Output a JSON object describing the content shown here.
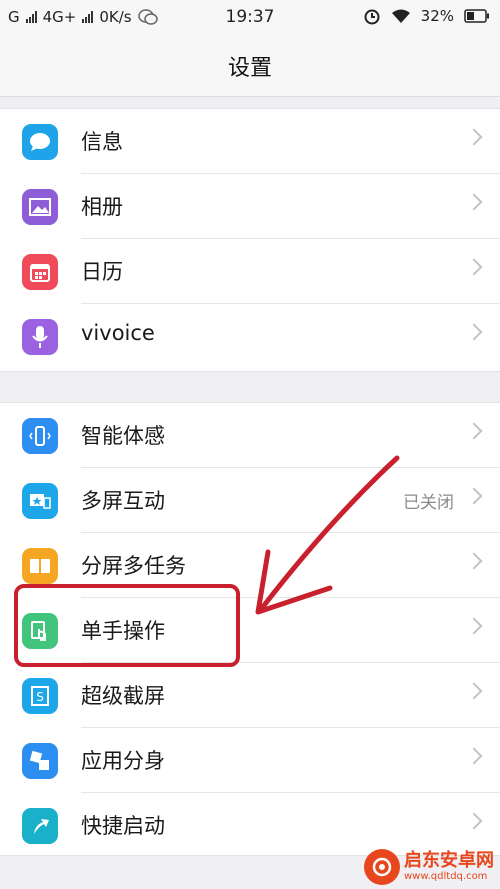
{
  "status_bar": {
    "carrier": "G",
    "network": "4G+",
    "speed": "0K/s",
    "time": "19:37",
    "battery": "32%"
  },
  "header": {
    "title": "设置"
  },
  "group1": [
    {
      "label": "信息",
      "icon": "message-icon",
      "color": "#1fa3e9"
    },
    {
      "label": "相册",
      "icon": "album-icon",
      "color": "#8e5ed9"
    },
    {
      "label": "日历",
      "icon": "calendar-icon",
      "color": "#ef4b5a"
    },
    {
      "label": "vivoice",
      "icon": "microphone-icon",
      "color": "#9a62e0"
    }
  ],
  "group2": [
    {
      "label": "智能体感",
      "icon": "phone-motion-icon",
      "color": "#2b8ef0",
      "value": ""
    },
    {
      "label": "多屏互动",
      "icon": "multiscreen-icon",
      "color": "#1da6e8",
      "value": "已关闭"
    },
    {
      "label": "分屏多任务",
      "icon": "split-screen-icon",
      "color": "#f5a623",
      "value": ""
    },
    {
      "label": "单手操作",
      "icon": "one-hand-icon",
      "color": "#41c47c",
      "value": ""
    },
    {
      "label": "超级截屏",
      "icon": "screenshot-icon",
      "color": "#1da6e8",
      "value": ""
    },
    {
      "label": "应用分身",
      "icon": "app-clone-icon",
      "color": "#2b8ef0",
      "value": ""
    },
    {
      "label": "快捷启动",
      "icon": "quick-launch-icon",
      "color": "#1ab0c9",
      "value": ""
    }
  ],
  "watermark": {
    "name": "启东安卓网",
    "url": "www.qdltdq.com"
  }
}
